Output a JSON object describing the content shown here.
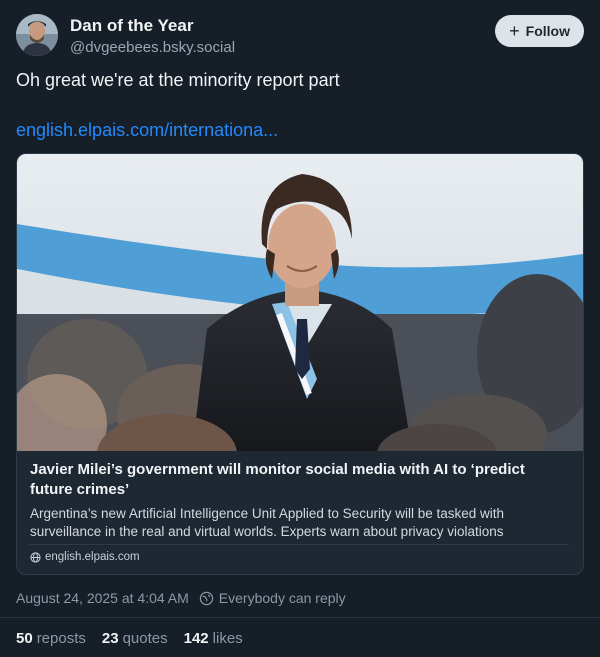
{
  "author": {
    "display_name": "Dan of the Year",
    "handle": "@dvgeebees.bsky.social",
    "avatar_icon": "user-avatar"
  },
  "follow_button": {
    "icon": "plus-icon",
    "label": "Follow"
  },
  "post": {
    "text": "Oh great we're at the minority report part",
    "link_text": "english.elpais.com/internationa..."
  },
  "embed": {
    "image": "photo-of-javier-milei-with-presidential-sash",
    "title": "Javier Milei’s government will monitor social media with AI to ‘predict future crimes’",
    "description": "Argentina’s new Artificial Intelligence Unit Applied to Security will be tasked with surveillance in the real and virtual worlds. Experts warn about privacy violations",
    "domain": "english.elpais.com",
    "domain_icon": "globe-icon"
  },
  "meta": {
    "timestamp": "August 24, 2025 at 4:04 AM",
    "reply_setting": "Everybody can reply",
    "reply_icon": "globe-reply-icon"
  },
  "stats": {
    "reposts_count": "50",
    "reposts_label": "reposts",
    "quotes_count": "23",
    "quotes_label": "quotes",
    "likes_count": "142",
    "likes_label": "likes"
  },
  "colors": {
    "background": "#161e27",
    "link": "#208bfe",
    "follow_bg": "#dde3e9",
    "muted": "#8d99a6"
  }
}
